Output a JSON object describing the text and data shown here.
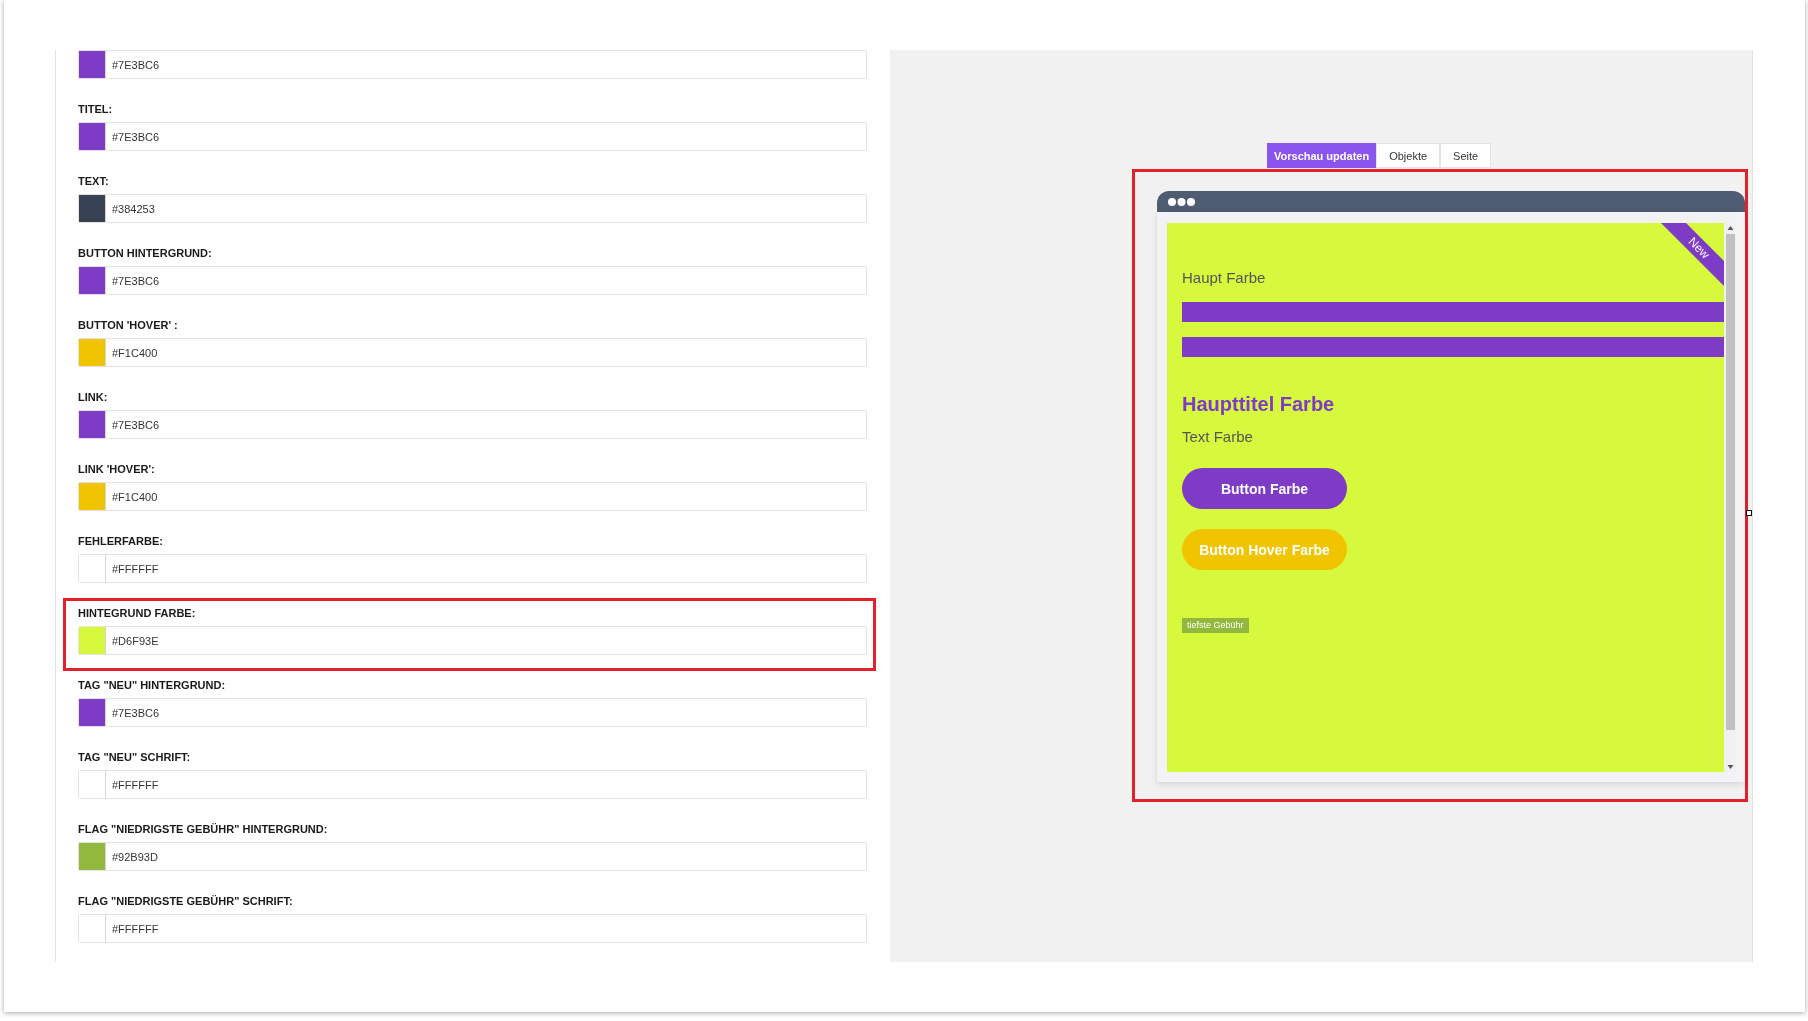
{
  "color_settings": {
    "fields": [
      {
        "value": "#7E3BC6",
        "color": "#7e3bc6",
        "highlighted": false
      },
      {
        "label": "TITEL:",
        "value": "#7E3BC6",
        "color": "#7e3bc6",
        "highlighted": false
      },
      {
        "label": "TEXT:",
        "value": "#384253",
        "color": "#384253",
        "highlighted": false
      },
      {
        "label": "BUTTON HINTERGRUND:",
        "value": "#7E3BC6",
        "color": "#7e3bc6",
        "highlighted": false
      },
      {
        "label": "BUTTON 'HOVER' :",
        "value": "#F1C400",
        "color": "#f1c400",
        "highlighted": false
      },
      {
        "label": "LINK:",
        "value": "#7E3BC6",
        "color": "#7e3bc6",
        "highlighted": false
      },
      {
        "label": "LINK 'HOVER':",
        "value": "#F1C400",
        "color": "#f1c400",
        "highlighted": false
      },
      {
        "label": "FEHLERFARBE:",
        "value": "#FFFFFF",
        "color": "#ffffff",
        "highlighted": false
      },
      {
        "label": "HINTEGRUND FARBE:",
        "value": "#D6F93E",
        "color": "#d6f93e",
        "highlighted": true
      },
      {
        "label": "TAG \"NEU\" HINTERGRUND:",
        "value": "#7E3BC6",
        "color": "#7e3bc6",
        "highlighted": false
      },
      {
        "label": "TAG \"NEU\" SCHRIFT:",
        "value": "#FFFFFF",
        "color": "#ffffff",
        "highlighted": false
      },
      {
        "label": "FLAG \"NIEDRIGSTE GEBÜHR\" HINTERGRUND:",
        "value": "#92B93D",
        "color": "#92b93d",
        "highlighted": false
      },
      {
        "label": "FLAG \"NIEDRIGSTE GEBÜHR\" SCHRIFT:",
        "value": "#FFFFFF",
        "color": "#ffffff",
        "highlighted": false
      }
    ]
  },
  "preview": {
    "tabs": [
      {
        "label": "Vorschau updaten",
        "selected": true
      },
      {
        "label": "Objekte",
        "selected": false
      },
      {
        "label": "Seite",
        "selected": false
      }
    ],
    "highlighted": true,
    "frame": {
      "ribbon": "New",
      "heading_label": "Haupt Farbe",
      "title": "Haupttitel Farbe",
      "text": "Text Farbe",
      "buttons": [
        {
          "label": "Button Farbe",
          "kind": "primary"
        },
        {
          "label": "Button Hover Farbe",
          "kind": "hover"
        }
      ],
      "flag": "tiefste Gebühr"
    }
  }
}
